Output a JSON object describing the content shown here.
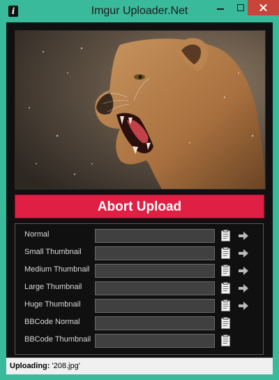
{
  "window": {
    "title": "Imgur Uploader.Net"
  },
  "actions": {
    "abort_label": "Abort Upload"
  },
  "links": [
    {
      "label": "Normal",
      "value": "",
      "has_open": true
    },
    {
      "label": "Small Thumbnail",
      "value": "",
      "has_open": true
    },
    {
      "label": "Medium Thumbnail",
      "value": "",
      "has_open": true
    },
    {
      "label": "Large Thumbnail",
      "value": "",
      "has_open": true
    },
    {
      "label": "Huge Thumbnail",
      "value": "",
      "has_open": true
    },
    {
      "label": "BBCode Normal",
      "value": "",
      "has_open": false
    },
    {
      "label": "BBCode Thumbnail",
      "value": "",
      "has_open": false
    }
  ],
  "status": {
    "prefix": "Uploading:",
    "file": "'208.jpg'"
  },
  "colors": {
    "titlebar": "#39ba9b",
    "abort": "#e01f45",
    "panel": "#101010"
  },
  "icons": {
    "clipboard": "clipboard-icon",
    "open": "arrow-right-icon"
  }
}
